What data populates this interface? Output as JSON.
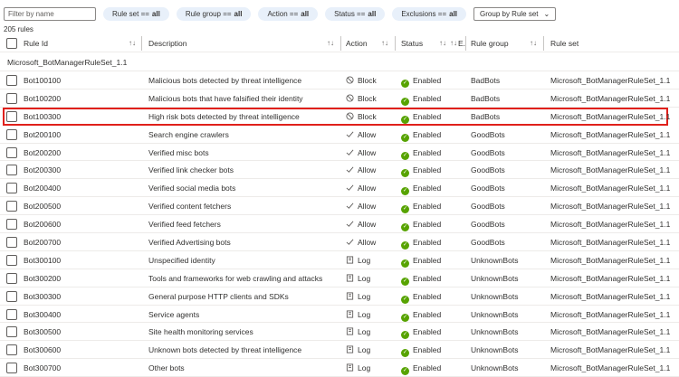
{
  "toolbar": {
    "filter_placeholder": "Filter by name",
    "pills": [
      {
        "label": "Rule set ==",
        "value": "all"
      },
      {
        "label": "Rule group ==",
        "value": "all"
      },
      {
        "label": "Action ==",
        "value": "all"
      },
      {
        "label": "Status ==",
        "value": "all"
      },
      {
        "label": "Exclusions ==",
        "value": "all"
      }
    ],
    "group_by": "Group by Rule set"
  },
  "rule_count": "205 rules",
  "columns": {
    "rule_id": "Rule Id",
    "description": "Description",
    "action": "Action",
    "status": "Status",
    "exclusions": "E.",
    "rule_group": "Rule group",
    "rule_set": "Rule set"
  },
  "group_title": "Microsoft_BotManagerRuleSet_1.1",
  "highlight_color": "#e0201b",
  "rows": [
    {
      "id": "Bot100100",
      "desc": "Malicious bots detected by threat intelligence",
      "action": "Block",
      "status": "Enabled",
      "group": "BadBots",
      "set": "Microsoft_BotManagerRuleSet_1.1"
    },
    {
      "id": "Bot100200",
      "desc": "Malicious bots that have falsified their identity",
      "action": "Block",
      "status": "Enabled",
      "group": "BadBots",
      "set": "Microsoft_BotManagerRuleSet_1.1"
    },
    {
      "id": "Bot100300",
      "desc": "High risk bots detected by threat intelligence",
      "action": "Block",
      "status": "Enabled",
      "group": "BadBots",
      "set": "Microsoft_BotManagerRuleSet_1.1",
      "highlighted": true
    },
    {
      "id": "Bot200100",
      "desc": "Search engine crawlers",
      "action": "Allow",
      "status": "Enabled",
      "group": "GoodBots",
      "set": "Microsoft_BotManagerRuleSet_1.1"
    },
    {
      "id": "Bot200200",
      "desc": "Verified misc bots",
      "action": "Allow",
      "status": "Enabled",
      "group": "GoodBots",
      "set": "Microsoft_BotManagerRuleSet_1.1"
    },
    {
      "id": "Bot200300",
      "desc": "Verified link checker bots",
      "action": "Allow",
      "status": "Enabled",
      "group": "GoodBots",
      "set": "Microsoft_BotManagerRuleSet_1.1"
    },
    {
      "id": "Bot200400",
      "desc": "Verified social media bots",
      "action": "Allow",
      "status": "Enabled",
      "group": "GoodBots",
      "set": "Microsoft_BotManagerRuleSet_1.1"
    },
    {
      "id": "Bot200500",
      "desc": "Verified content fetchers",
      "action": "Allow",
      "status": "Enabled",
      "group": "GoodBots",
      "set": "Microsoft_BotManagerRuleSet_1.1"
    },
    {
      "id": "Bot200600",
      "desc": "Verified feed fetchers",
      "action": "Allow",
      "status": "Enabled",
      "group": "GoodBots",
      "set": "Microsoft_BotManagerRuleSet_1.1"
    },
    {
      "id": "Bot200700",
      "desc": "Verified Advertising bots",
      "action": "Allow",
      "status": "Enabled",
      "group": "GoodBots",
      "set": "Microsoft_BotManagerRuleSet_1.1"
    },
    {
      "id": "Bot300100",
      "desc": "Unspecified identity",
      "action": "Log",
      "status": "Enabled",
      "group": "UnknownBots",
      "set": "Microsoft_BotManagerRuleSet_1.1"
    },
    {
      "id": "Bot300200",
      "desc": "Tools and frameworks for web crawling and attacks",
      "action": "Log",
      "status": "Enabled",
      "group": "UnknownBots",
      "set": "Microsoft_BotManagerRuleSet_1.1"
    },
    {
      "id": "Bot300300",
      "desc": "General purpose HTTP clients and SDKs",
      "action": "Log",
      "status": "Enabled",
      "group": "UnknownBots",
      "set": "Microsoft_BotManagerRuleSet_1.1"
    },
    {
      "id": "Bot300400",
      "desc": "Service agents",
      "action": "Log",
      "status": "Enabled",
      "group": "UnknownBots",
      "set": "Microsoft_BotManagerRuleSet_1.1"
    },
    {
      "id": "Bot300500",
      "desc": "Site health monitoring services",
      "action": "Log",
      "status": "Enabled",
      "group": "UnknownBots",
      "set": "Microsoft_BotManagerRuleSet_1.1"
    },
    {
      "id": "Bot300600",
      "desc": "Unknown bots detected by threat intelligence",
      "action": "Log",
      "status": "Enabled",
      "group": "UnknownBots",
      "set": "Microsoft_BotManagerRuleSet_1.1"
    },
    {
      "id": "Bot300700",
      "desc": "Other bots",
      "action": "Log",
      "status": "Enabled",
      "group": "UnknownBots",
      "set": "Microsoft_BotManagerRuleSet_1.1"
    }
  ]
}
